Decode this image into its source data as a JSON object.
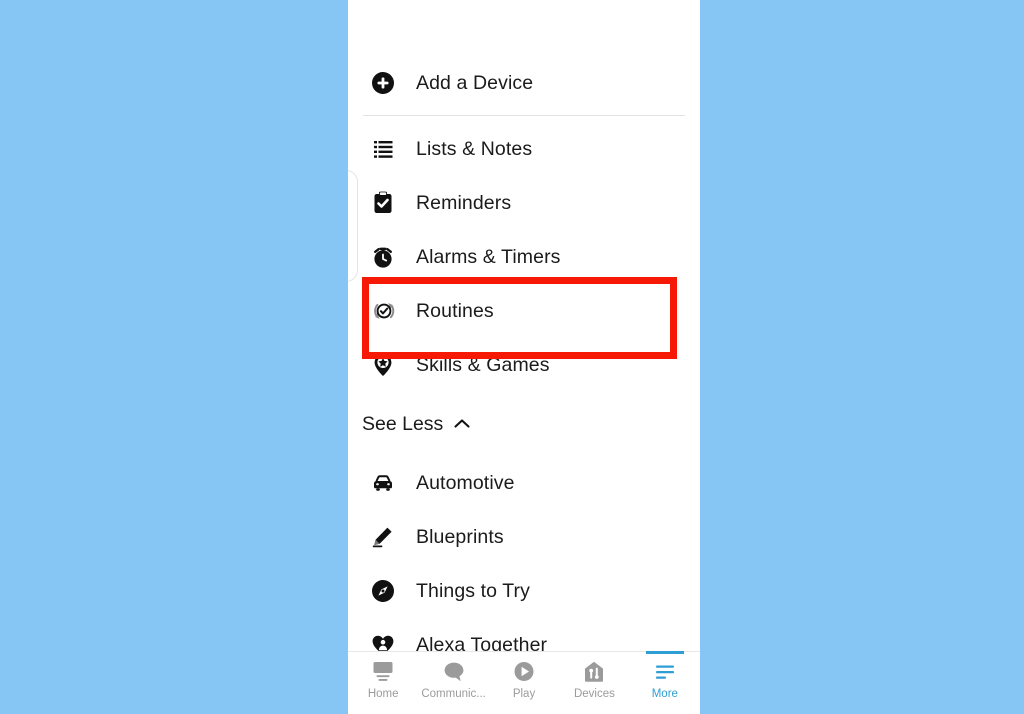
{
  "background_color": "#85c6f5",
  "panel": {
    "background": "#ffffff",
    "text_color": "#1b1b1b"
  },
  "highlight": {
    "color": "#f61a06",
    "target": "Routines"
  },
  "menu": {
    "add_device": {
      "label": "Add a Device",
      "icon": "plus-circle-icon"
    },
    "items": [
      {
        "label": "Lists & Notes",
        "icon": "list-lines-icon"
      },
      {
        "label": "Reminders",
        "icon": "clipboard-check-icon"
      },
      {
        "label": "Alarms & Timers",
        "icon": "alarm-clock-icon"
      },
      {
        "label": "Routines",
        "icon": "refresh-check-icon"
      },
      {
        "label": "Skills & Games",
        "icon": "map-pin-star-icon"
      }
    ],
    "see_less": {
      "label": "See Less",
      "icon": "chevron-up-icon"
    },
    "more_items": [
      {
        "label": "Automotive",
        "icon": "car-icon"
      },
      {
        "label": "Blueprints",
        "icon": "pencil-icon"
      },
      {
        "label": "Things to Try",
        "icon": "compass-icon"
      },
      {
        "label": "Alexa Together",
        "icon": "heart-person-icon"
      }
    ]
  },
  "bottom_nav": {
    "active_color": "#2f9ed4",
    "inactive_color": "#9b9b9b",
    "items": [
      {
        "label": "Home",
        "icon": "home-screen-icon",
        "active": false
      },
      {
        "label": "Communic...",
        "icon": "chat-bubble-icon",
        "active": false
      },
      {
        "label": "Play",
        "icon": "play-circle-icon",
        "active": false
      },
      {
        "label": "Devices",
        "icon": "devices-home-icon",
        "active": false
      },
      {
        "label": "More",
        "icon": "hamburger-icon",
        "active": true
      }
    ]
  }
}
